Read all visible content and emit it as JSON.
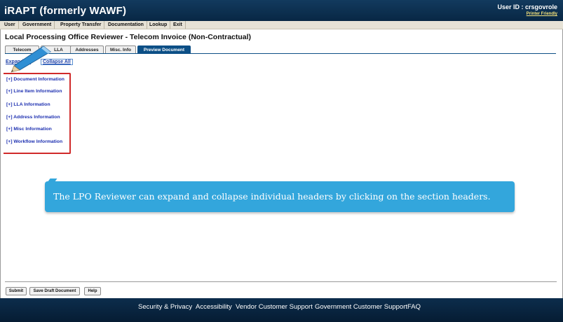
{
  "header": {
    "app_title": "iRAPT (formerly WAWF)",
    "user_id": "User ID : crsgovrole",
    "printer_friendly": "Printer Friendly"
  },
  "menu": [
    "User",
    "Government",
    "Property Transfer",
    "Documentation",
    "Lookup",
    "Exit"
  ],
  "page_title": "Local Processing Office Reviewer - Telecom Invoice (Non-Contractual)",
  "tabs": [
    "Telecom",
    "LLA",
    "Addresses",
    "Misc. Info",
    "Preview Document"
  ],
  "active_tab": "Preview Document",
  "links": {
    "expand_all": "Expand All",
    "collapse_all": "Collapse All"
  },
  "sections": [
    "[+] Document Information",
    "[+] Line Item Information",
    "[+] LLA Information",
    "[+] Address Information",
    "[+] Misc Information",
    "[+] Workflow Information"
  ],
  "callout": "The LPO Reviewer can expand and collapse individual headers by clicking on the section headers.",
  "buttons": [
    "Submit",
    "Save Draft Document",
    "Help"
  ],
  "footer": [
    "Security & Privacy",
    "Accessibility",
    "Vendor Customer Support",
    "Government Customer Support",
    "FAQ"
  ],
  "colors": {
    "header": "#0a2f52",
    "active_tab": "#0c4f86",
    "callout": "#33a6dc",
    "highlight_box": "#d02a2a"
  }
}
